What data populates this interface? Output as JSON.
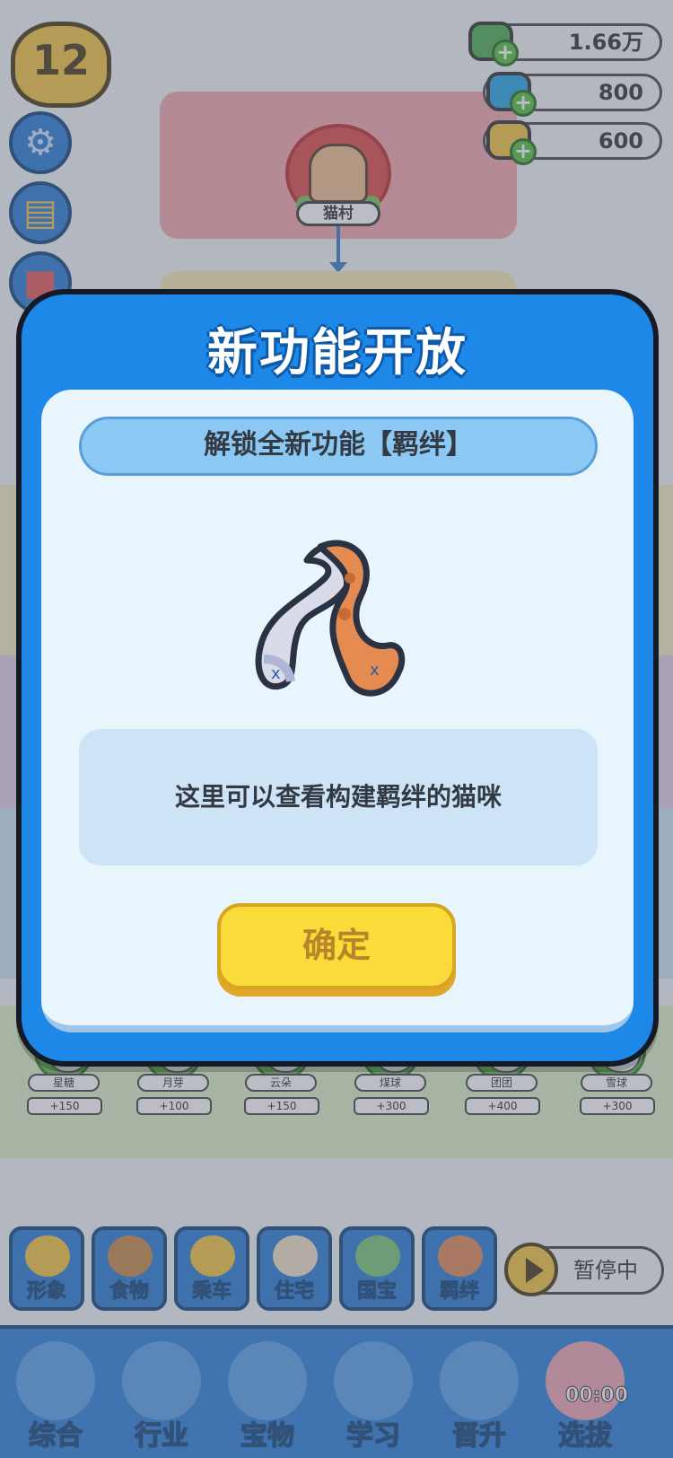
{
  "top": {
    "level": "12",
    "currencies": [
      {
        "name": "coin",
        "value": "1.66万",
        "color": "#4caf50"
      },
      {
        "name": "gem",
        "value": "800",
        "color": "#2aa7e8"
      },
      {
        "name": "fish",
        "value": "600",
        "color": "#f5c542"
      }
    ]
  },
  "map": {
    "village_name": "猫村"
  },
  "cats": [
    {
      "name": "星糖",
      "reward": "+150"
    },
    {
      "name": "月芽",
      "reward": "+100"
    },
    {
      "name": "云朵",
      "reward": "+150"
    },
    {
      "name": "煤球",
      "reward": "+300"
    },
    {
      "name": "团团",
      "reward": "+400"
    },
    {
      "name": "雪球",
      "reward": "+300"
    }
  ],
  "features": [
    {
      "label": "形象"
    },
    {
      "label": "食物"
    },
    {
      "label": "乘车"
    },
    {
      "label": "住宅"
    },
    {
      "label": "国宝"
    },
    {
      "label": "羁绊"
    }
  ],
  "pause": {
    "label": "暂停中"
  },
  "tabs": [
    {
      "label": "综合"
    },
    {
      "label": "行业"
    },
    {
      "label": "宝物"
    },
    {
      "label": "学习"
    },
    {
      "label": "晋升"
    },
    {
      "label": "选拔"
    }
  ],
  "timer": "00:00",
  "modal": {
    "title": "新功能开放",
    "subtitle": "解锁全新功能【羁绊】",
    "description": "这里可以查看构建羁绊的猫咪",
    "confirm_label": "确定"
  }
}
